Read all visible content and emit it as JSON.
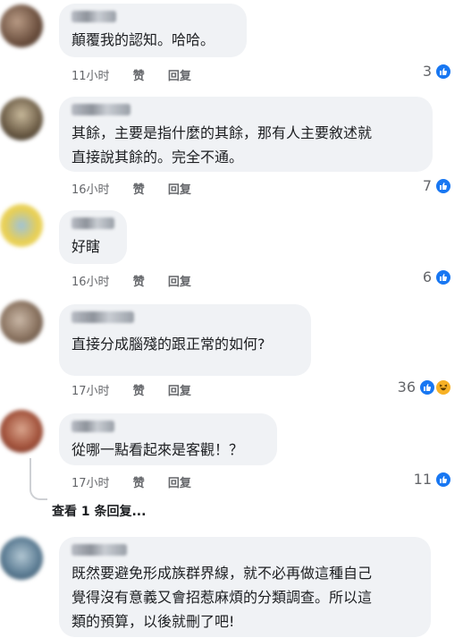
{
  "comments": [
    {
      "text_lines": [
        "顛覆我的認知。哈哈。"
      ],
      "time": "11小时",
      "like": "赞",
      "reply": "回复",
      "reactions": "3",
      "avatar_colors": [
        "#6b4f3e",
        "#b89a84",
        "#3f2e25"
      ]
    },
    {
      "text_lines": [
        "其餘，主要是指什麼的其餘，那有人主要敘述就",
        "直接說其餘的。完全不通。"
      ],
      "time": "16小时",
      "like": "赞",
      "reply": "回复",
      "reactions": "7",
      "avatar_colors": [
        "#6a5a44",
        "#c7b89a",
        "#2d2a24"
      ]
    },
    {
      "text_lines": [
        "好瞎"
      ],
      "time": "16小时",
      "like": "赞",
      "reply": "回复",
      "reactions": "6",
      "avatar_colors": [
        "#e8cf54",
        "#9fc3d8",
        "#f2e07e"
      ]
    },
    {
      "text_lines": [
        "直接分成腦殘的跟正常的如何?"
      ],
      "time": "17小时",
      "like": "赞",
      "reply": "回复",
      "reactions": "36",
      "avatar_colors": [
        "#8a7360",
        "#c9b7a6",
        "#4a3a30"
      ]
    },
    {
      "text_lines": [
        "從哪一點看起來是客觀！？"
      ],
      "time": "17小时",
      "like": "赞",
      "reply": "回复",
      "reactions": "11",
      "avatar_colors": [
        "#a4553e",
        "#d9a48c",
        "#6b2f23"
      ]
    },
    {
      "text_lines": [
        "既然要避免形成族群界線，就不必再做這種自己",
        "覺得沒有意義又會招惹麻煩的分類調查。所以這",
        "類的預算，以後就刪了吧!"
      ],
      "avatar_colors": [
        "#5f7f96",
        "#b2c7d3",
        "#2f4a5e"
      ]
    }
  ],
  "view_replies": "查看 1 条回复...",
  "colors": {
    "like_blue": "#1877f2",
    "haha_yellow": "#f7b125",
    "bubble": "#f0f2f5"
  }
}
